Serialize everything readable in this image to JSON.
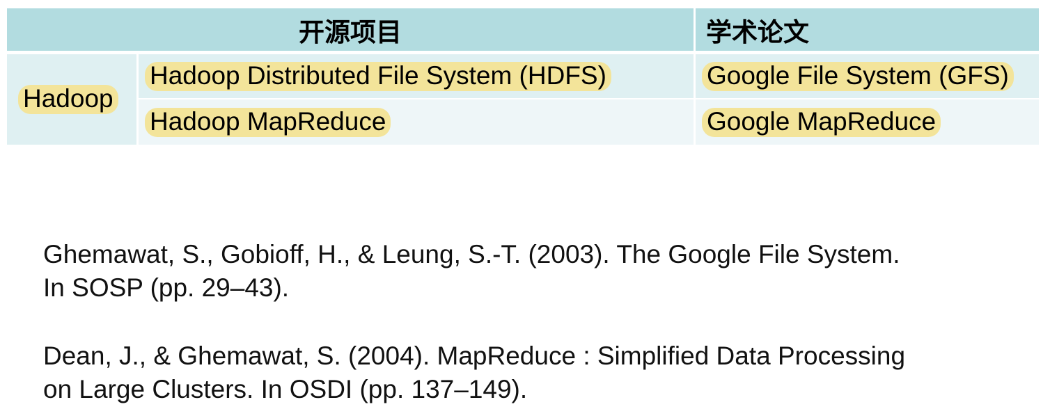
{
  "table": {
    "header": {
      "open_source": "开源项目",
      "papers": "学术论文"
    },
    "group_label": "Hadoop",
    "rows": [
      {
        "project": "Hadoop Distributed File System (HDFS)",
        "paper": "Google File System (GFS)"
      },
      {
        "project": "Hadoop MapReduce",
        "paper": "Google MapReduce"
      }
    ],
    "colors": {
      "header_bg": "#b2dce0",
      "row_bg_light": "#dff0f2",
      "row_bg_lighter": "#eef6f8",
      "highlight": "#f3e49a"
    }
  },
  "references": [
    {
      "line1": "Ghemawat, S., Gobioff, H., & Leung, S.-T. (2003). The Google File System.",
      "line2": "In SOSP (pp. 29–43)."
    },
    {
      "line1": "Dean, J., & Ghemawat, S. (2004). MapReduce : Simplified Data Processing",
      "line2": "on Large Clusters. In OSDI (pp. 137–149)."
    }
  ]
}
